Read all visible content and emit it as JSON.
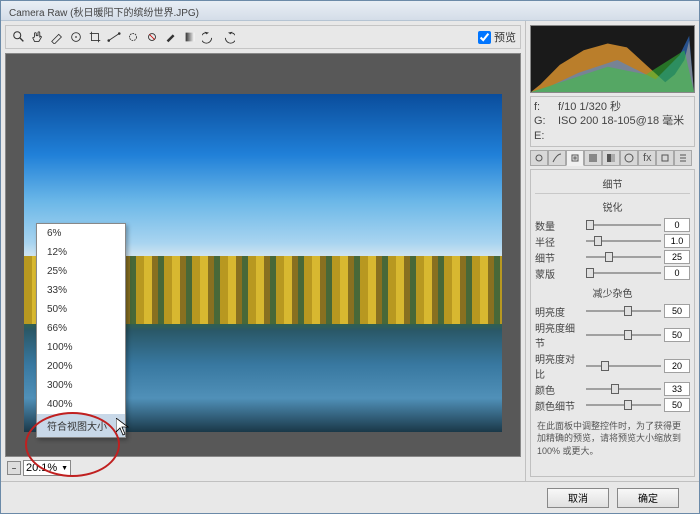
{
  "window": {
    "title": "Camera Raw (秋日暖阳下的缤纷世界.JPG)"
  },
  "toolbar": {
    "preview_label": "预览"
  },
  "zoom": {
    "current": "20.1%",
    "menu": [
      "6%",
      "12%",
      "25%",
      "33%",
      "50%",
      "66%",
      "100%",
      "200%",
      "300%",
      "400%",
      "符合视图大小"
    ],
    "selected_index": 10
  },
  "meta": {
    "rows": [
      {
        "k": "f:",
        "v": "f/10   1/320 秒"
      },
      {
        "k": "G:",
        "v": "ISO 200   18-105@18 毫米"
      },
      {
        "k": "E:",
        "v": ""
      }
    ]
  },
  "panel": {
    "title": "细节",
    "sharpen": {
      "title": "锐化",
      "items": [
        {
          "label": "数量",
          "value": "0",
          "pos": 0
        },
        {
          "label": "半径",
          "value": "1.0",
          "pos": 10
        },
        {
          "label": "细节",
          "value": "25",
          "pos": 25
        },
        {
          "label": "蒙版",
          "value": "0",
          "pos": 0
        }
      ]
    },
    "noise": {
      "title": "减少杂色",
      "items": [
        {
          "label": "明亮度",
          "value": "50",
          "pos": 50
        },
        {
          "label": "明亮度细节",
          "value": "50",
          "pos": 50
        },
        {
          "label": "明亮度对比",
          "value": "20",
          "pos": 20
        },
        {
          "label": "颜色",
          "value": "33",
          "pos": 33
        },
        {
          "label": "颜色细节",
          "value": "50",
          "pos": 50
        }
      ]
    },
    "hint": "在此面板中调整控件时，为了获得更加精确的预览，请将预览大小缩放到 100% 或更大。"
  },
  "footer": {
    "cancel": "取消",
    "ok": "确定"
  }
}
